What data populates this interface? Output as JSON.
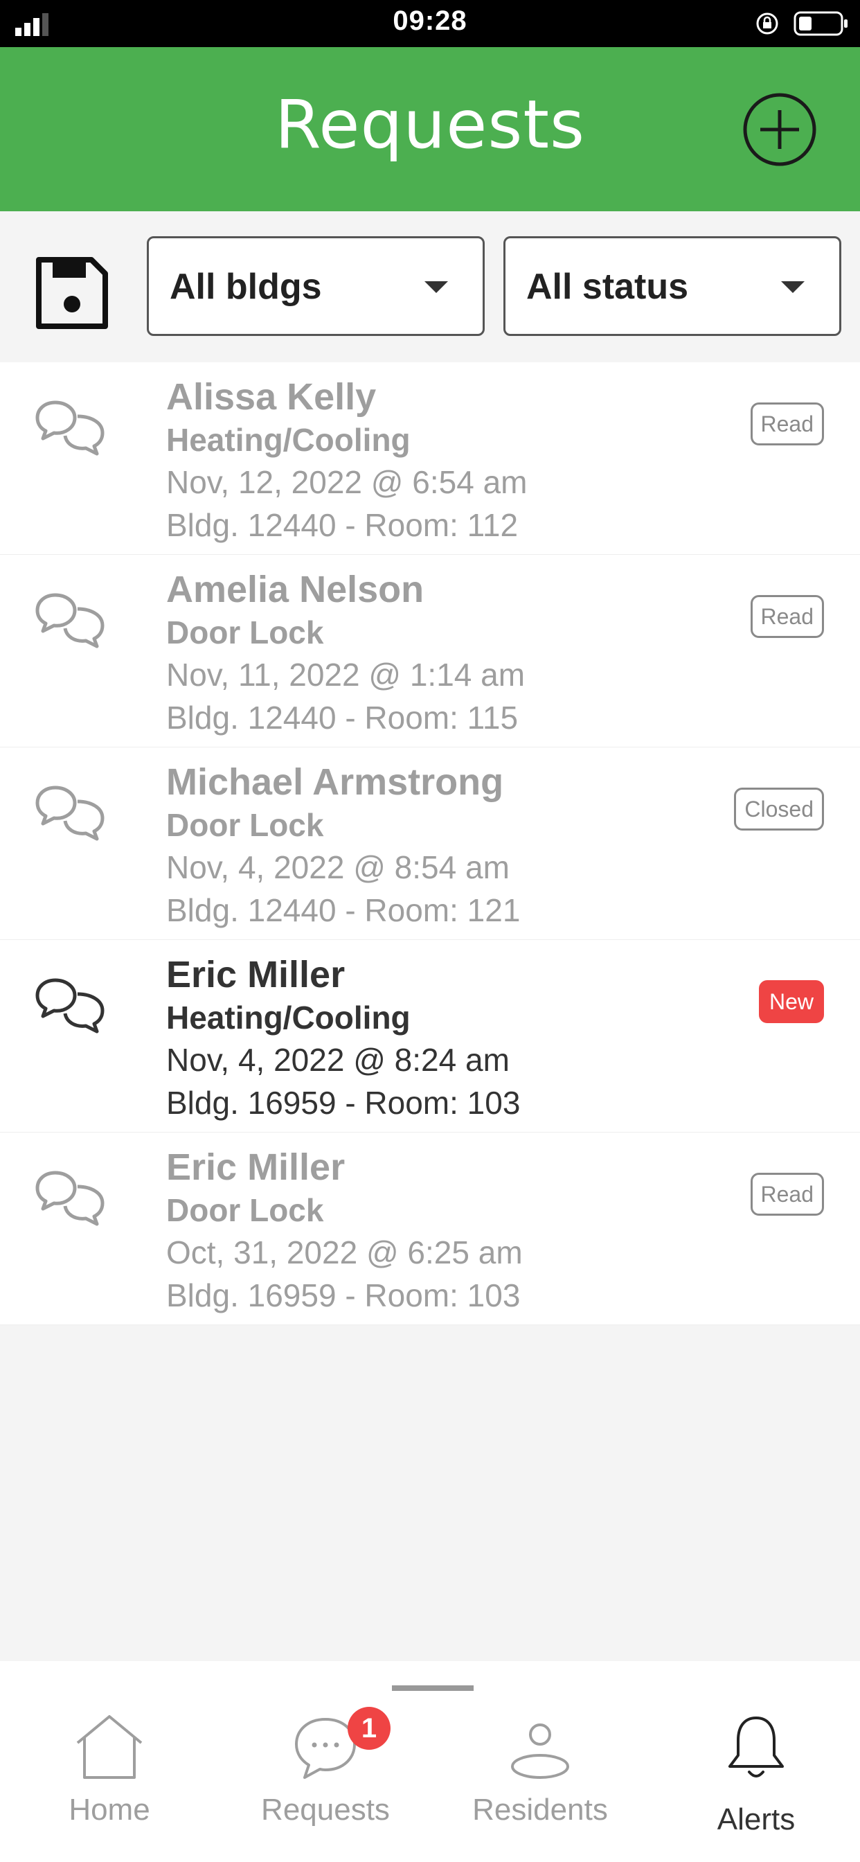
{
  "status_bar": {
    "time": "09:28"
  },
  "header": {
    "title": "Requests",
    "add_icon": "plus-circle-icon"
  },
  "filters": {
    "save_icon": "floppy-disk-icon",
    "building": {
      "selected": "All bldgs"
    },
    "status": {
      "selected": "All status"
    }
  },
  "requests": [
    {
      "name": "Alissa Kelly",
      "category": "Heating/Cooling",
      "date": "Nov, 12, 2022 @ 6:54 am",
      "location": "Bldg. 12440 - Room: 112",
      "status": "Read"
    },
    {
      "name": "Amelia Nelson",
      "category": "Door Lock",
      "date": "Nov, 11, 2022 @ 1:14 am",
      "location": "Bldg. 12440 - Room: 115",
      "status": "Read"
    },
    {
      "name": "Michael Armstrong",
      "category": "Door Lock",
      "date": "Nov, 4, 2022 @ 8:54 am",
      "location": "Bldg. 12440 - Room: 121",
      "status": "Closed"
    },
    {
      "name": "Eric Miller",
      "category": "Heating/Cooling",
      "date": "Nov, 4, 2022 @ 8:24 am",
      "location": "Bldg. 16959 - Room: 103",
      "status": "New"
    },
    {
      "name": "Eric Miller",
      "category": "Door Lock",
      "date": "Oct, 31, 2022 @ 6:25 am",
      "location": "Bldg. 16959 - Room: 103",
      "status": "Read"
    }
  ],
  "colors": {
    "header_green": "#4caf50",
    "new_badge": "#ef4444",
    "muted_text": "#9e9e9e"
  },
  "bottom_nav": {
    "items": [
      {
        "label": "Home",
        "icon": "home-icon"
      },
      {
        "label": "Requests",
        "icon": "chat-bubble-icon",
        "badge": "1"
      },
      {
        "label": "Residents",
        "icon": "person-icon"
      },
      {
        "label": "Alerts",
        "icon": "bell-icon",
        "active": true
      }
    ]
  }
}
